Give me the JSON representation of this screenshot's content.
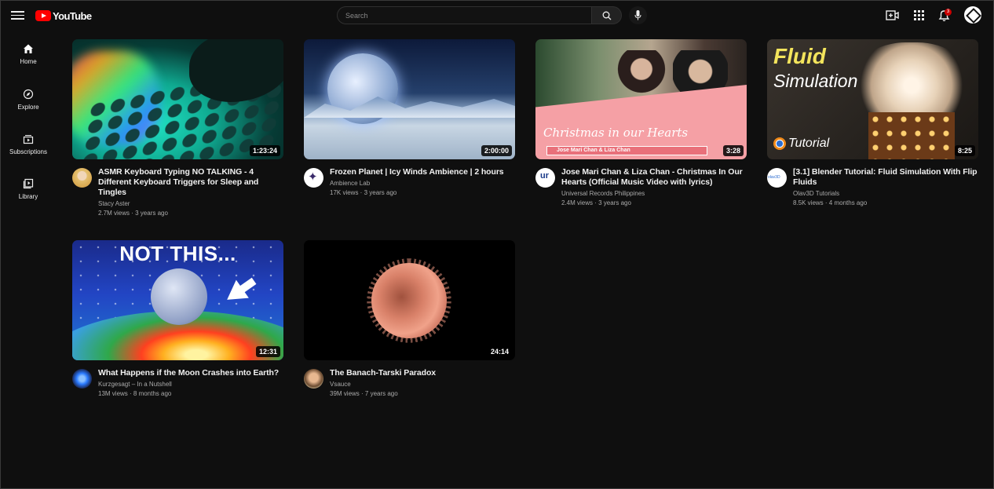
{
  "header": {
    "logo_text": "YouTube",
    "search_placeholder": "Search",
    "notification_count": "3"
  },
  "sidebar": {
    "items": [
      {
        "label": "Home",
        "icon": "home-icon"
      },
      {
        "label": "Explore",
        "icon": "compass-icon"
      },
      {
        "label": "Subscriptions",
        "icon": "subscriptions-icon"
      },
      {
        "label": "Library",
        "icon": "library-icon"
      }
    ]
  },
  "videos": [
    {
      "title": "ASMR Keyboard Typing NO TALKING - 4 Different Keyboard Triggers for Sleep and Tingles",
      "channel": "Stacy Aster",
      "stats": "2.7M views · 3 years ago",
      "duration": "1:23:24"
    },
    {
      "title": "Frozen Planet | Icy Winds Ambience | 2 hours",
      "channel": "Ambience Lab",
      "stats": "17K views · 3 years ago",
      "duration": "2:00:00"
    },
    {
      "title": "Jose Mari Chan & Liza Chan - Christmas In Our Hearts (Official Music Video with lyrics)",
      "channel": "Universal Records Philippines",
      "stats": "2.4M views · 3 years ago",
      "duration": "3:28",
      "thumb_text": "Christmas in our Hearts",
      "thumb_banner": "Jose Mari Chan & Liza Chan"
    },
    {
      "title": "[3.1] Blender Tutorial: Fluid Simulation With Flip Fluids",
      "channel": "Olav3D Tutorials",
      "stats": "8.5K views · 4 months ago",
      "duration": "8:25",
      "thumb_line1": "Fluid",
      "thumb_line2": "Simulation",
      "thumb_line3": "Tutorial"
    },
    {
      "title": "What Happens if the Moon Crashes into Earth?",
      "channel": "Kurzgesagt – In a Nutshell",
      "stats": "13M views · 8 months ago",
      "duration": "12:31",
      "thumb_text": "NOT THIS..."
    },
    {
      "title": "The Banach-Tarski Paradox",
      "channel": "Vsauce",
      "stats": "39M views · 7 years ago",
      "duration": "24:14"
    }
  ]
}
